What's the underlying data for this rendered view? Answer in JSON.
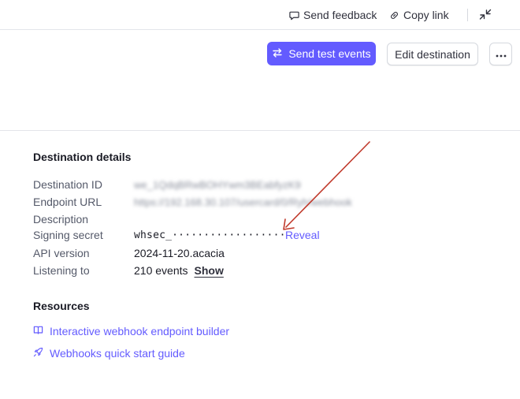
{
  "topbar": {
    "send_feedback": "Send feedback",
    "copy_link": "Copy link"
  },
  "header_actions": {
    "send_test_events": "Send test events",
    "edit_destination": "Edit destination"
  },
  "destination_details": {
    "title": "Destination details",
    "rows": [
      {
        "label": "Destination ID",
        "value": "we_1QdqBRwBOHYwm3BEabfyzK9"
      },
      {
        "label": "Endpoint URL",
        "value": "https://192.168.30.107/usercard/0/Ryh/webhook"
      },
      {
        "label": "Description",
        "value": ""
      },
      {
        "label": "Signing secret",
        "value": "whsec_··················",
        "link": "Reveal"
      },
      {
        "label": "API version",
        "value": "2024-11-20.acacia"
      },
      {
        "label": "Listening to",
        "value": "210 events",
        "link": "Show"
      }
    ]
  },
  "resources": {
    "title": "Resources",
    "items": [
      {
        "label": "Interactive webhook endpoint builder",
        "icon": "book-icon"
      },
      {
        "label": "Webhooks quick start guide",
        "icon": "rocket-icon"
      }
    ]
  },
  "colors": {
    "accent": "#635bff",
    "annotation_arrow": "#c0392b",
    "text": "#1a1b25",
    "muted": "#545969"
  }
}
